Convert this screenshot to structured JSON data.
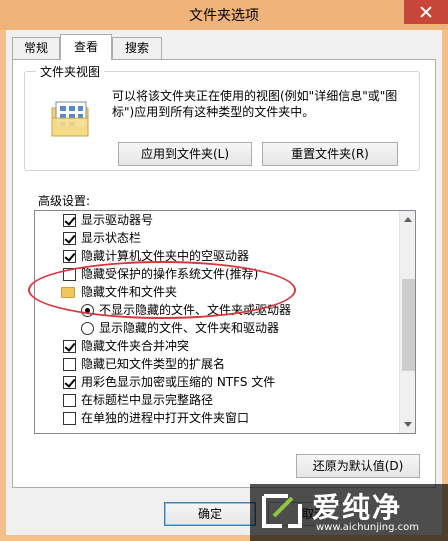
{
  "window": {
    "title": "文件夹选项"
  },
  "tabs": [
    {
      "label": "常规",
      "active": false
    },
    {
      "label": "查看",
      "active": true
    },
    {
      "label": "搜索",
      "active": false
    }
  ],
  "folder_views": {
    "group_title": "文件夹视图",
    "description": "可以将该文件夹正在使用的视图(例如\"详细信息\"或\"图标\")应用到所有这种类型的文件夹中。",
    "apply_button": "应用到文件夹(L)",
    "reset_button": "重置文件夹(R)"
  },
  "advanced": {
    "label": "高级设置:",
    "items": [
      {
        "type": "checkbox",
        "label": "显示驱动器号",
        "checked": true
      },
      {
        "type": "checkbox",
        "label": "显示状态栏",
        "checked": true
      },
      {
        "type": "checkbox",
        "label": "隐藏计算机文件夹中的空驱动器",
        "checked": true
      },
      {
        "type": "checkbox",
        "label": "隐藏受保护的操作系统文件(推荐)",
        "checked": false
      },
      {
        "type": "folder",
        "label": "隐藏文件和文件夹"
      },
      {
        "type": "radio",
        "label": "不显示隐藏的文件、文件夹或驱动器",
        "checked": true
      },
      {
        "type": "radio",
        "label": "显示隐藏的文件、文件夹和驱动器",
        "checked": false
      },
      {
        "type": "checkbox",
        "label": "隐藏文件夹合并冲突",
        "checked": true
      },
      {
        "type": "checkbox",
        "label": "隐藏已知文件类型的扩展名",
        "checked": false
      },
      {
        "type": "checkbox",
        "label": "用彩色显示加密或压缩的 NTFS 文件",
        "checked": true
      },
      {
        "type": "checkbox",
        "label": "在标题栏中显示完整路径",
        "checked": false
      },
      {
        "type": "checkbox",
        "label": "在单独的进程中打开文件夹窗口",
        "checked": false
      }
    ]
  },
  "restore_button": "还原为默认值(D)",
  "ok_button": "确定",
  "cancel_button": "取消",
  "watermark": {
    "text": "爱纯净",
    "url": "www.aichunjing.com"
  },
  "colors": {
    "highlight_ellipse": "#d9363e",
    "title_bar": "#f0b47a"
  }
}
